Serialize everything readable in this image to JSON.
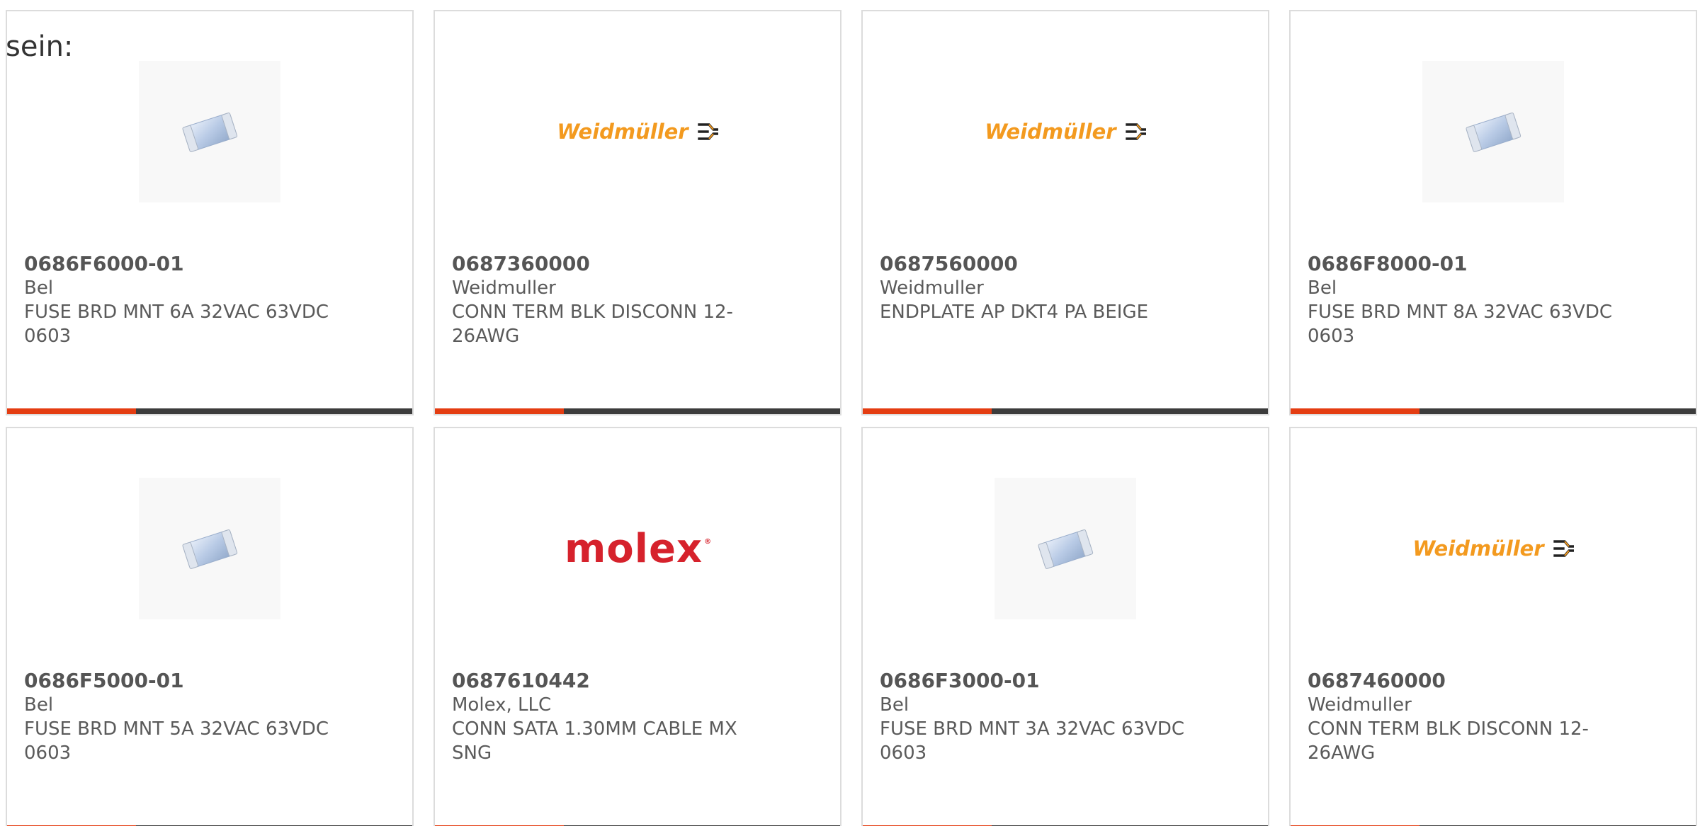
{
  "intro": "sein:",
  "colors": {
    "accent": "#e43d12",
    "bar": "#3c3c3c",
    "border": "#dcdcdc",
    "weidmuller_orange": "#f39a1f",
    "molex_red": "#d6222c"
  },
  "products": [
    {
      "part_number": "0686F6000-01",
      "manufacturer": "Bel",
      "description": "FUSE BRD MNT 6A 32VAC 63VDC 0603",
      "image": "fuse-chip-image"
    },
    {
      "part_number": "0687360000",
      "manufacturer": "Weidmuller",
      "description": "CONN TERM BLK DISCONN 12-26AWG",
      "image": "weidmuller-logo",
      "logo_text": "Weidmüller"
    },
    {
      "part_number": "0687560000",
      "manufacturer": "Weidmuller",
      "description": "ENDPLATE AP DKT4 PA BEIGE",
      "image": "weidmuller-logo",
      "logo_text": "Weidmüller"
    },
    {
      "part_number": "0686F8000-01",
      "manufacturer": "Bel",
      "description": "FUSE BRD MNT 8A 32VAC 63VDC 0603",
      "image": "fuse-chip-image"
    },
    {
      "part_number": "0686F5000-01",
      "manufacturer": "Bel",
      "description": "FUSE BRD MNT 5A 32VAC 63VDC 0603",
      "image": "fuse-chip-image"
    },
    {
      "part_number": "0687610442",
      "manufacturer": "Molex, LLC",
      "description": "CONN SATA 1.30MM CABLE MX SNG",
      "image": "molex-logo",
      "logo_text": "molex"
    },
    {
      "part_number": "0686F3000-01",
      "manufacturer": "Bel",
      "description": "FUSE BRD MNT 3A 32VAC 63VDC 0603",
      "image": "fuse-chip-image"
    },
    {
      "part_number": "0687460000",
      "manufacturer": "Weidmuller",
      "description": "CONN TERM BLK DISCONN 12-26AWG",
      "image": "weidmuller-logo",
      "logo_text": "Weidmüller"
    }
  ]
}
